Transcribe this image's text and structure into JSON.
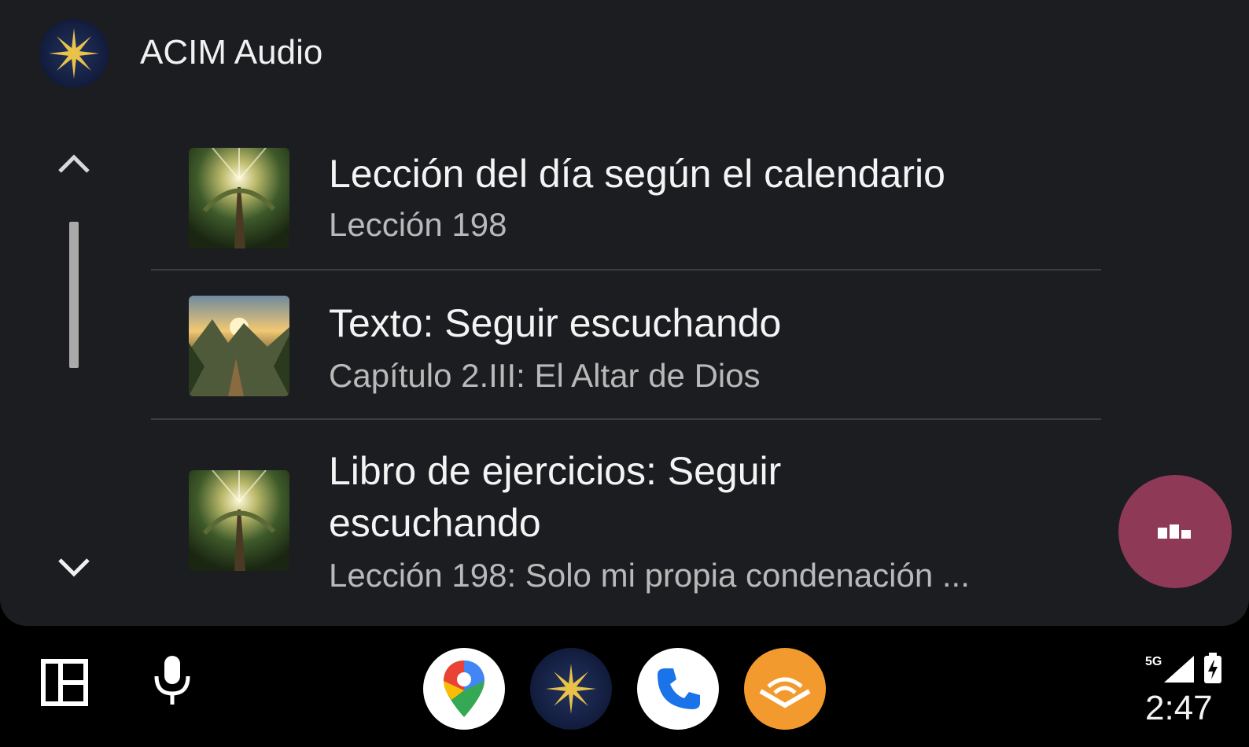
{
  "header": {
    "title": "ACIM Audio",
    "logo_icon": "sun-star-icon"
  },
  "list": {
    "items": [
      {
        "title": "Lección del día según el calendario",
        "subtitle": "Lección 198",
        "thumb": "forest-light"
      },
      {
        "title": "Texto: Seguir escuchando",
        "subtitle": "Capítulo 2.III: El Altar de Dios",
        "thumb": "mountain-sunset"
      },
      {
        "title": "Libro de ejercicios: Seguir escuchando",
        "subtitle": "Lección 198: Solo mi propia condenación ...",
        "thumb": "forest-light"
      }
    ]
  },
  "scroll": {
    "up_icon": "chevron-up-icon",
    "down_icon": "chevron-down-icon"
  },
  "fab": {
    "icon": "now-playing-icon",
    "color": "#8e3a56"
  },
  "dock": {
    "left": [
      "dashboard-icon",
      "microphone-icon"
    ],
    "apps": [
      "google-maps",
      "acim-audio",
      "phone",
      "audible"
    ]
  },
  "status": {
    "network": "5G",
    "time": "2:47"
  }
}
